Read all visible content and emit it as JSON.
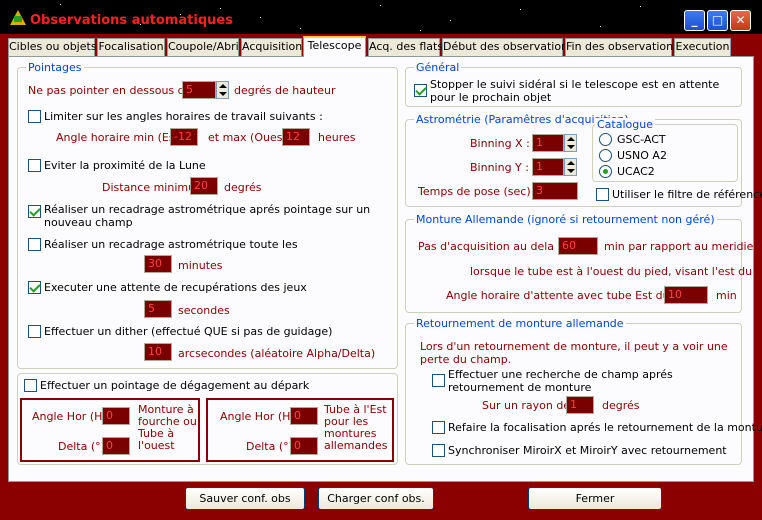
{
  "window": {
    "title": "Observations automatiques",
    "minimize": "_",
    "maximize": "□",
    "close": "✕"
  },
  "tabs": [
    "Cibles ou objets",
    "Focalisation",
    "Coupole/Abri",
    "Acquisition",
    "Telescope",
    "Acq. des flats",
    "Début des observations",
    "Fin des observations",
    "Execution"
  ],
  "active_tab": "Telescope",
  "pointages": {
    "title": "Pointages",
    "min_alt_prefix": "Ne pas pointer en dessous de",
    "min_alt_value": "5",
    "min_alt_suffix": "degrés de hauteur",
    "limit_hour_angle_label": "Limiter sur les angles horaires de travail suivants :",
    "limit_hour_angle_checked": false,
    "ha_min_label": "Angle horaire min (Est)",
    "ha_min_value": "-12",
    "ha_max_label": "et max (Ouest)",
    "ha_max_value": "12",
    "ha_unit": "heures",
    "avoid_moon_label": "Eviter la proximité de la Lune",
    "avoid_moon_checked": false,
    "min_distance_label": "Distance minimum",
    "min_distance_value": "20",
    "min_distance_unit": "degrés",
    "recadrage_new_label": "Réaliser un recadrage astrométrique aprés pointage sur un nouveau champ",
    "recadrage_new_checked": true,
    "recadrage_periodic_label": "Réaliser un recadrage astrométrique toute les",
    "recadrage_periodic_checked": false,
    "recadrage_minutes_value": "30",
    "recadrage_minutes_unit": "minutes",
    "wait_label": "Executer une attente de recupérations des jeux",
    "wait_checked": true,
    "wait_value": "5",
    "wait_unit": "secondes",
    "dither_label": "Effectuer un dither (effectué QUE si pas de guidage)",
    "dither_checked": false,
    "dither_value": "10",
    "dither_unit": "arcsecondes (aléatoire Alpha/Delta)"
  },
  "degagement": {
    "label": "Effectuer un pointage de dégagement au dépark",
    "checked": false,
    "left": {
      "ah_label": "Angle Hor (H)",
      "ah_value": "0",
      "delta_label": "Delta (°)",
      "delta_value": "0",
      "desc": "Monture à fourche ou Tube à l'ouest"
    },
    "right": {
      "ah_label": "Angle Hor (H)",
      "ah_value": "0",
      "delta_label": "Delta (°)",
      "delta_value": "0",
      "desc": "Tube à l'Est pour les montures allemandes"
    }
  },
  "general": {
    "title": "Général",
    "stop_label": "Stopper le suivi sidéral si le telescope est en attente pour le prochain objet",
    "stop_checked": true
  },
  "astrometrie": {
    "title": "Astrométrie (Paramêtres d'acquisition)",
    "binx_label": "Binning X :",
    "binx_value": "1",
    "biny_label": "Binning Y :",
    "biny_value": "1",
    "pose_label": "Temps de pose (sec) :",
    "pose_value": "3",
    "catalogue_title": "Catalogue",
    "catalogues": [
      "GSC-ACT",
      "USNO A2",
      "UCAC2"
    ],
    "catalogue_selected": "UCAC2",
    "filter_label": "Utiliser le filtre de référence",
    "filter_checked": false
  },
  "monture": {
    "title": "Monture Allemande (ignoré si retournement non géré)",
    "pas_label": "Pas d'acquisition au dela de",
    "pas_value": "60",
    "pas_suffix": "min par rapport au meridien",
    "ouest_label": "lorsque le tube est à l'ouest du pied, visant l'est du ciel",
    "attente_label": "Angle horaire d'attente avec tube Est du pied",
    "attente_value": "10",
    "attente_unit": "min"
  },
  "retournement": {
    "title": "Retournement de monture allemande",
    "info": "Lors d'un retournement de monture, il peut y a voir une perte du champ.",
    "search_label": "Effectuer une recherche de champ aprés retournement de monture",
    "search_checked": false,
    "rayon_label": "Sur un rayon de",
    "rayon_value": "1",
    "rayon_unit": "degrés",
    "focus_label": "Refaire la focalisation aprés le retournement de la monture",
    "focus_checked": false,
    "sync_label": "Synchroniser MiroirX et MiroirY avec retournement",
    "sync_checked": false
  },
  "footer": {
    "save": "Sauver conf. obs",
    "load": "Charger conf obs.",
    "close": "Fermer"
  }
}
